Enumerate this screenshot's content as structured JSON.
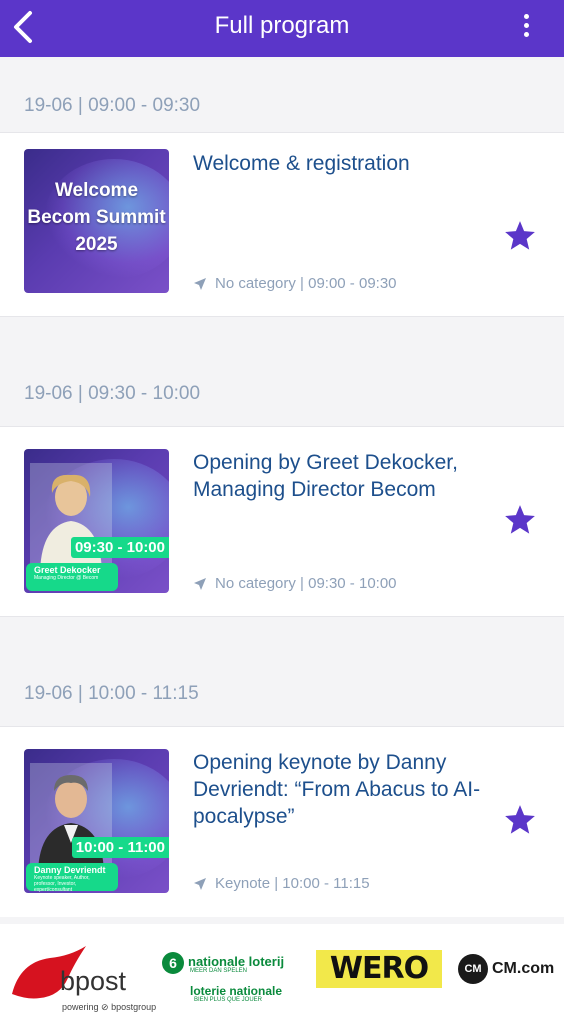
{
  "header": {
    "title": "Full program",
    "back_icon": "chevron-left-icon",
    "menu_icon": "more-vertical-icon",
    "background_color": "#5b36c9"
  },
  "sessions": [
    {
      "slot": "19-06 | 09:00 - 09:30",
      "title": "Welcome & registration",
      "meta": "No category | 09:00 - 09:30",
      "thumb_text": [
        "Welcome",
        "Becom Summit",
        "2025"
      ],
      "favorite": true
    },
    {
      "slot": "19-06 | 09:30 - 10:00",
      "title": "Opening by Greet Dekocker, Managing Director Becom",
      "meta": "No category | 09:30 - 10:00",
      "thumb_time": "09:30 - 10:00",
      "thumb_name": "Greet Dekocker",
      "thumb_role": "Managing Director @ Becom",
      "favorite": true
    },
    {
      "slot": "19-06 | 10:00 - 11:15",
      "title": "Opening keynote by Danny Devriendt: “From Abacus to AI-pocalypse”",
      "meta": "Keynote | 10:00 - 11:15",
      "thumb_time": "10:00 - 11:00",
      "thumb_name": "Danny Devriendt",
      "thumb_role": "Keynote speaker, Author, professor, Investor, expert/consultant",
      "favorite": true
    }
  ],
  "sponsors": {
    "bpost": {
      "name": "bpost",
      "tagline": "powering ⊘ bpostgroup"
    },
    "loterij": {
      "line1": "nationale loterij",
      "line2": "MEER DAN SPELEN",
      "line3": "loterie nationale",
      "line4": "BIEN PLUS QUE JOUER"
    },
    "wero": {
      "name": "WERO"
    },
    "cm": {
      "badge": "CM",
      "name": "CM.com"
    }
  },
  "colors": {
    "accent": "#5b36c9",
    "title_text": "#1d4f8c",
    "meta_text": "#8ea0b8",
    "badge_green": "#16d98a",
    "star": "#5b36c9"
  }
}
